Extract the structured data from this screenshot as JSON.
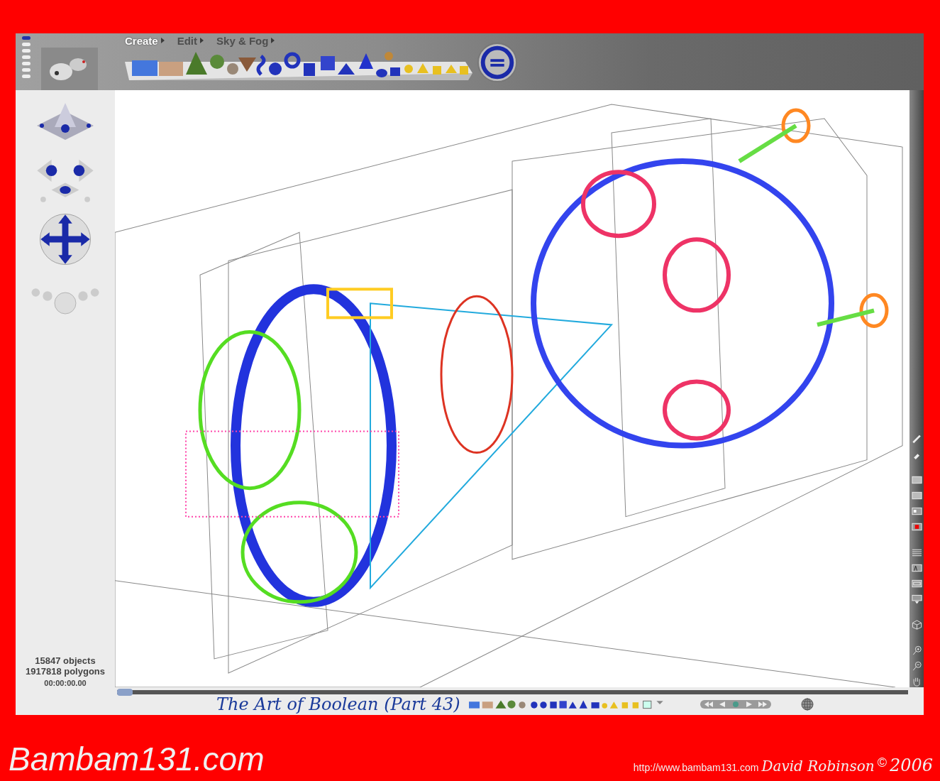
{
  "menu": [
    {
      "label": "Create",
      "selected": true
    },
    {
      "label": "Edit",
      "selected": false
    },
    {
      "label": "Sky & Fog",
      "selected": false
    }
  ],
  "status": {
    "objects": "15847 objects",
    "polygons": "1917818 polygons",
    "time": "00:00:00.00"
  },
  "timeline": {
    "level": 0
  },
  "document_title": "The Art of Boolean (Part 43)",
  "footer": {
    "site": "Bambam131.com",
    "url": "http://www.bambam131.com",
    "author": "David Robinson",
    "copyright": "©",
    "year": "2006"
  }
}
